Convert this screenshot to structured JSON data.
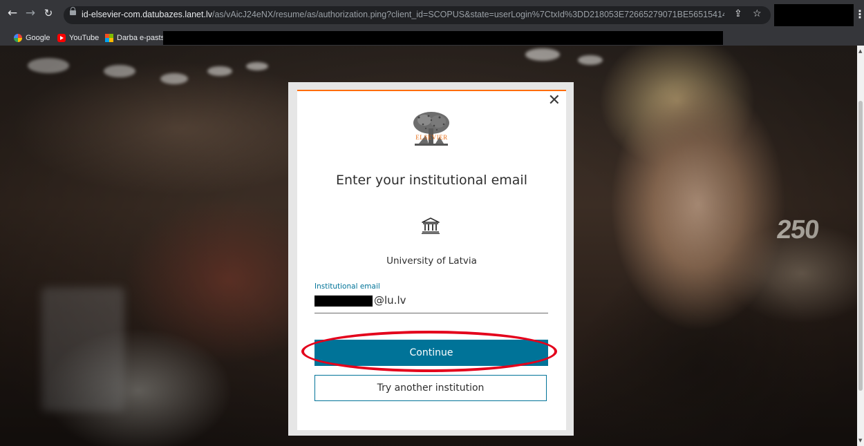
{
  "browser": {
    "nav": {
      "back_icon": "back-arrow-icon",
      "forward_icon": "forward-arrow-icon",
      "reload_icon": "reload-icon"
    },
    "address_bar": {
      "host": "id-elsevier-com.datubazes.lanet.lv",
      "path": "/as/vAicJ24eNX/resume/as/authorization.ping?client_id=SCOPUS&state=userLogin%7CtxId%3DD218053E72665279071BE56515414E55.i-0871eb3b795..."
    },
    "bookmarks": [
      {
        "label": "Google",
        "icon": "google-icon"
      },
      {
        "label": "YouTube",
        "icon": "youtube-icon"
      },
      {
        "label": "Darba e-pasts",
        "icon": "microsoft-icon"
      }
    ]
  },
  "background": {
    "sign": "250"
  },
  "modal": {
    "close_label": "✕",
    "logo_text": "ELSEVIER",
    "title": "Enter your institutional email",
    "institution_icon": "institution-icon",
    "institution_name": "University of Latvia",
    "email_label": "Institutional email",
    "email_value": "@lu.lv",
    "continue_label": "Continue",
    "another_label": "Try another institution"
  },
  "colors": {
    "accent_orange": "#ff6c00",
    "primary_blue": "#007398",
    "highlight_red": "#e3001b",
    "chrome_dark": "#35363a"
  }
}
